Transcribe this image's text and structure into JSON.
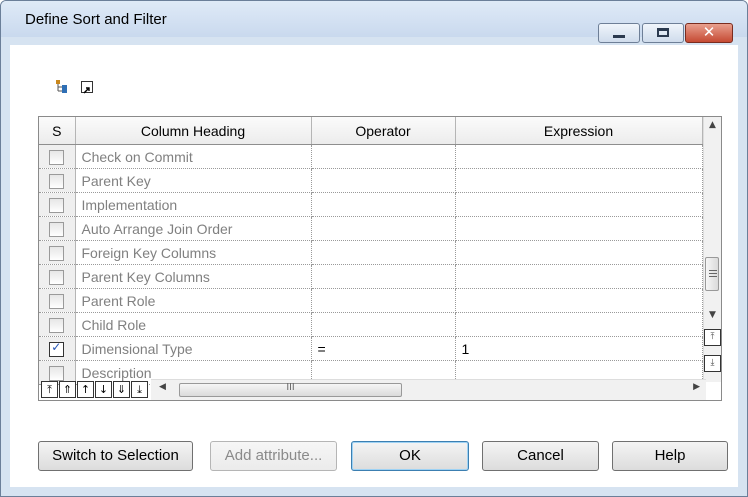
{
  "window": {
    "title": "Define Sort and Filter",
    "controls": {
      "minimize": "minimize-icon",
      "maximize": "maximize-icon",
      "close": "✕"
    }
  },
  "toolbar": {
    "icons": [
      "tree-view-icon",
      "open-link-icon"
    ]
  },
  "grid": {
    "headers": [
      "S",
      "Column Heading",
      "Operator",
      "Expression"
    ],
    "rows": [
      {
        "checked": false,
        "heading": "Check on Commit",
        "operator": "",
        "expression": ""
      },
      {
        "checked": false,
        "heading": "Parent Key",
        "operator": "",
        "expression": ""
      },
      {
        "checked": false,
        "heading": "Implementation",
        "operator": "",
        "expression": ""
      },
      {
        "checked": false,
        "heading": "Auto Arrange Join Order",
        "operator": "",
        "expression": ""
      },
      {
        "checked": false,
        "heading": "Foreign Key Columns",
        "operator": "",
        "expression": ""
      },
      {
        "checked": false,
        "heading": "Parent Key Columns",
        "operator": "",
        "expression": ""
      },
      {
        "checked": false,
        "heading": "Parent Role",
        "operator": "",
        "expression": ""
      },
      {
        "checked": false,
        "heading": "Child Role",
        "operator": "",
        "expression": ""
      },
      {
        "checked": true,
        "heading": "Dimensional Type",
        "operator": "=",
        "expression": "1"
      },
      {
        "checked": false,
        "heading": "Description",
        "operator": "",
        "expression": ""
      }
    ],
    "nav_buttons": [
      "⤒",
      "⇑",
      "↑",
      "↓",
      "⇓",
      "⤓"
    ],
    "hscroll_label": "III"
  },
  "buttons": {
    "switch": "Switch to Selection",
    "add_attribute": "Add attribute...",
    "ok": "OK",
    "cancel": "Cancel",
    "help": "Help"
  }
}
